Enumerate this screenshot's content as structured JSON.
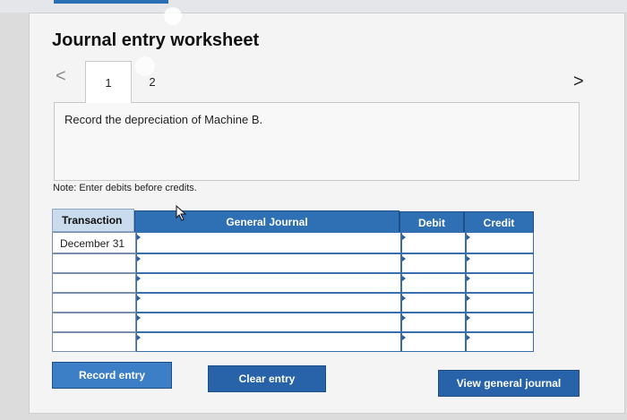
{
  "title": "Journal entry worksheet",
  "nav": {
    "prev": "<",
    "next": ">"
  },
  "tabs": [
    {
      "label": "1"
    },
    {
      "label": "2"
    }
  ],
  "prompt": "Record the depreciation of Machine B.",
  "note": "Note: Enter debits before credits.",
  "table": {
    "headers": {
      "transaction": "Transaction",
      "journal": "General Journal",
      "debit": "Debit",
      "credit": "Credit"
    },
    "rows": [
      {
        "transaction": "December 31",
        "journal": "",
        "debit": "",
        "credit": ""
      },
      {
        "transaction": "",
        "journal": "",
        "debit": "",
        "credit": ""
      },
      {
        "transaction": "",
        "journal": "",
        "debit": "",
        "credit": ""
      },
      {
        "transaction": "",
        "journal": "",
        "debit": "",
        "credit": ""
      },
      {
        "transaction": "",
        "journal": "",
        "debit": "",
        "credit": ""
      },
      {
        "transaction": "",
        "journal": "",
        "debit": "",
        "credit": ""
      }
    ]
  },
  "buttons": {
    "record": "Record entry",
    "clear": "Clear entry",
    "view": "View general journal"
  },
  "colors": {
    "accent": "#2862a8",
    "header_blue": "#2f6fb4",
    "background": "#f4f4f4"
  }
}
